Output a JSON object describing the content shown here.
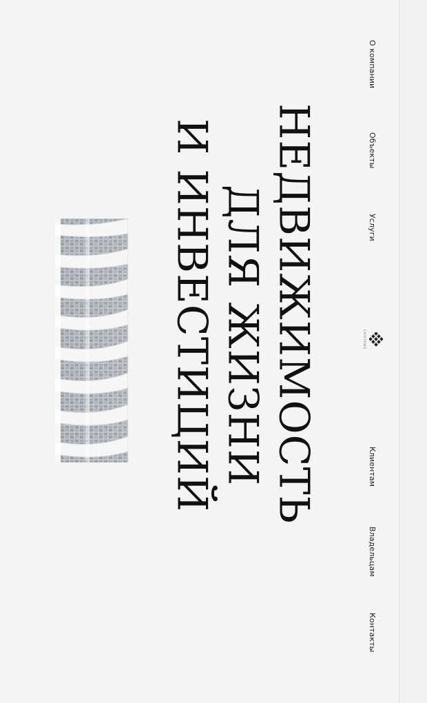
{
  "nav": {
    "items": [
      {
        "label": "О компании"
      },
      {
        "label": "Объекты"
      },
      {
        "label": "Услуги"
      },
      {
        "label": "Клиентам"
      },
      {
        "label": "Владельцам"
      },
      {
        "label": "Контакты"
      }
    ]
  },
  "logo": {
    "text": "CRISTOWS",
    "icon": "lattice-logo-icon"
  },
  "hero": {
    "line1": "Недвижимость",
    "line2": "для жизни",
    "line3": "и инвестиций"
  },
  "colors": {
    "background": "#f4f4f4",
    "text": "#111111",
    "rail": "#e2e2e2"
  }
}
